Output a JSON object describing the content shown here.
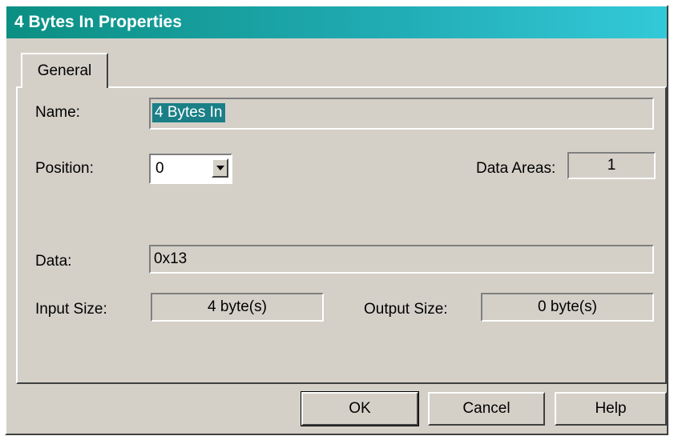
{
  "window": {
    "title": "4 Bytes In Properties"
  },
  "tabs": [
    {
      "label": "General"
    }
  ],
  "fields": {
    "name_label": "Name:",
    "name_value": "4 Bytes In",
    "position_label": "Position:",
    "position_value": "0",
    "data_areas_label": "Data Areas:",
    "data_areas_value": "1",
    "data_label": "Data:",
    "data_value": "0x13",
    "input_size_label": "Input Size:",
    "input_size_value": "4 byte(s)",
    "output_size_label": "Output Size:",
    "output_size_value": "0 byte(s)"
  },
  "buttons": {
    "ok": "OK",
    "cancel": "Cancel",
    "help": "Help"
  },
  "colors": {
    "title_gradient_start": "#0b8f82",
    "title_gradient_end": "#33c9d8",
    "dialog_face": "#d4d0c8",
    "selection": "#1a7f86"
  },
  "icons": {
    "position_dropdown": "chevron-down-icon"
  }
}
